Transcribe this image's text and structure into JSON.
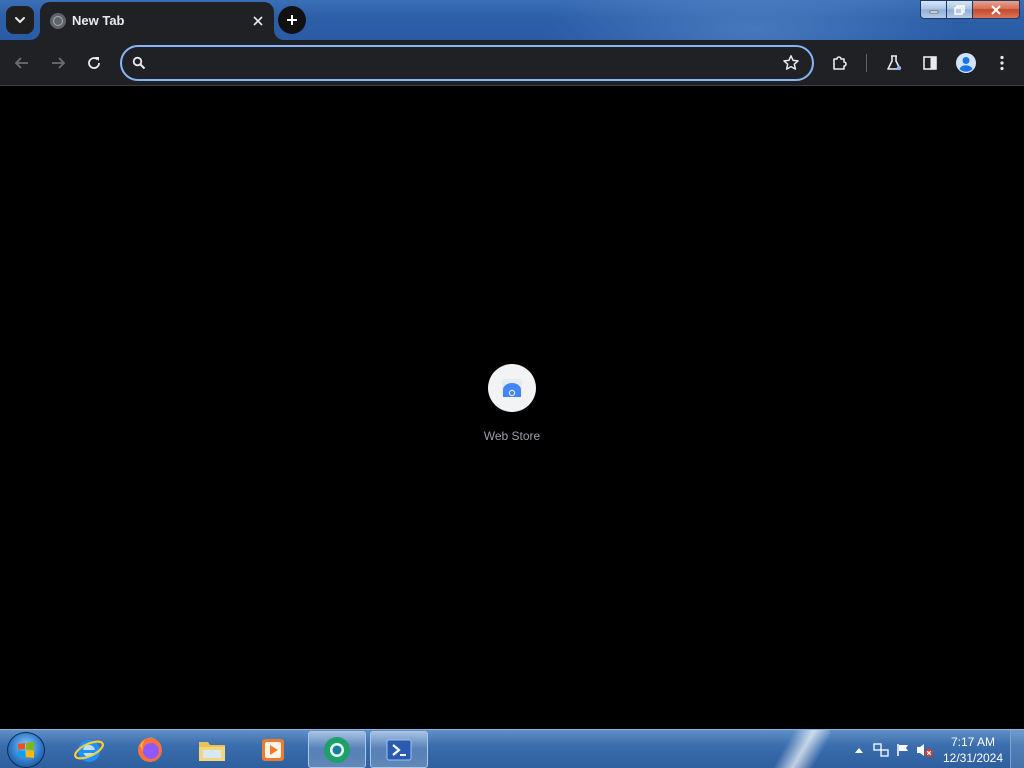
{
  "window": {
    "tab_title": "New Tab"
  },
  "toolbar": {
    "omnibox_value": ""
  },
  "content": {
    "shortcut_label": "Web Store"
  },
  "taskbar": {
    "apps": [
      "Internet Explorer",
      "Firefox",
      "File Explorer",
      "Media Player",
      "Chrome",
      "PowerShell"
    ],
    "clock_time": "7:17 AM",
    "clock_date": "12/31/2024"
  },
  "colors": {
    "accent": "#8ab4f8",
    "toolbar_bg": "#202124",
    "content_bg": "#000000",
    "taskbar": "#3b6eae"
  },
  "icons": {
    "tab_search": "chevron-down-icon",
    "new_tab": "plus-icon",
    "back": "arrow-left-icon",
    "forward": "arrow-right-icon",
    "reload": "reload-icon",
    "bookmark": "star-icon",
    "extensions": "puzzle-icon",
    "labs": "flask-icon",
    "side_panel": "side-panel-icon",
    "profile": "avatar-icon",
    "menu": "kebab-menu-icon"
  }
}
